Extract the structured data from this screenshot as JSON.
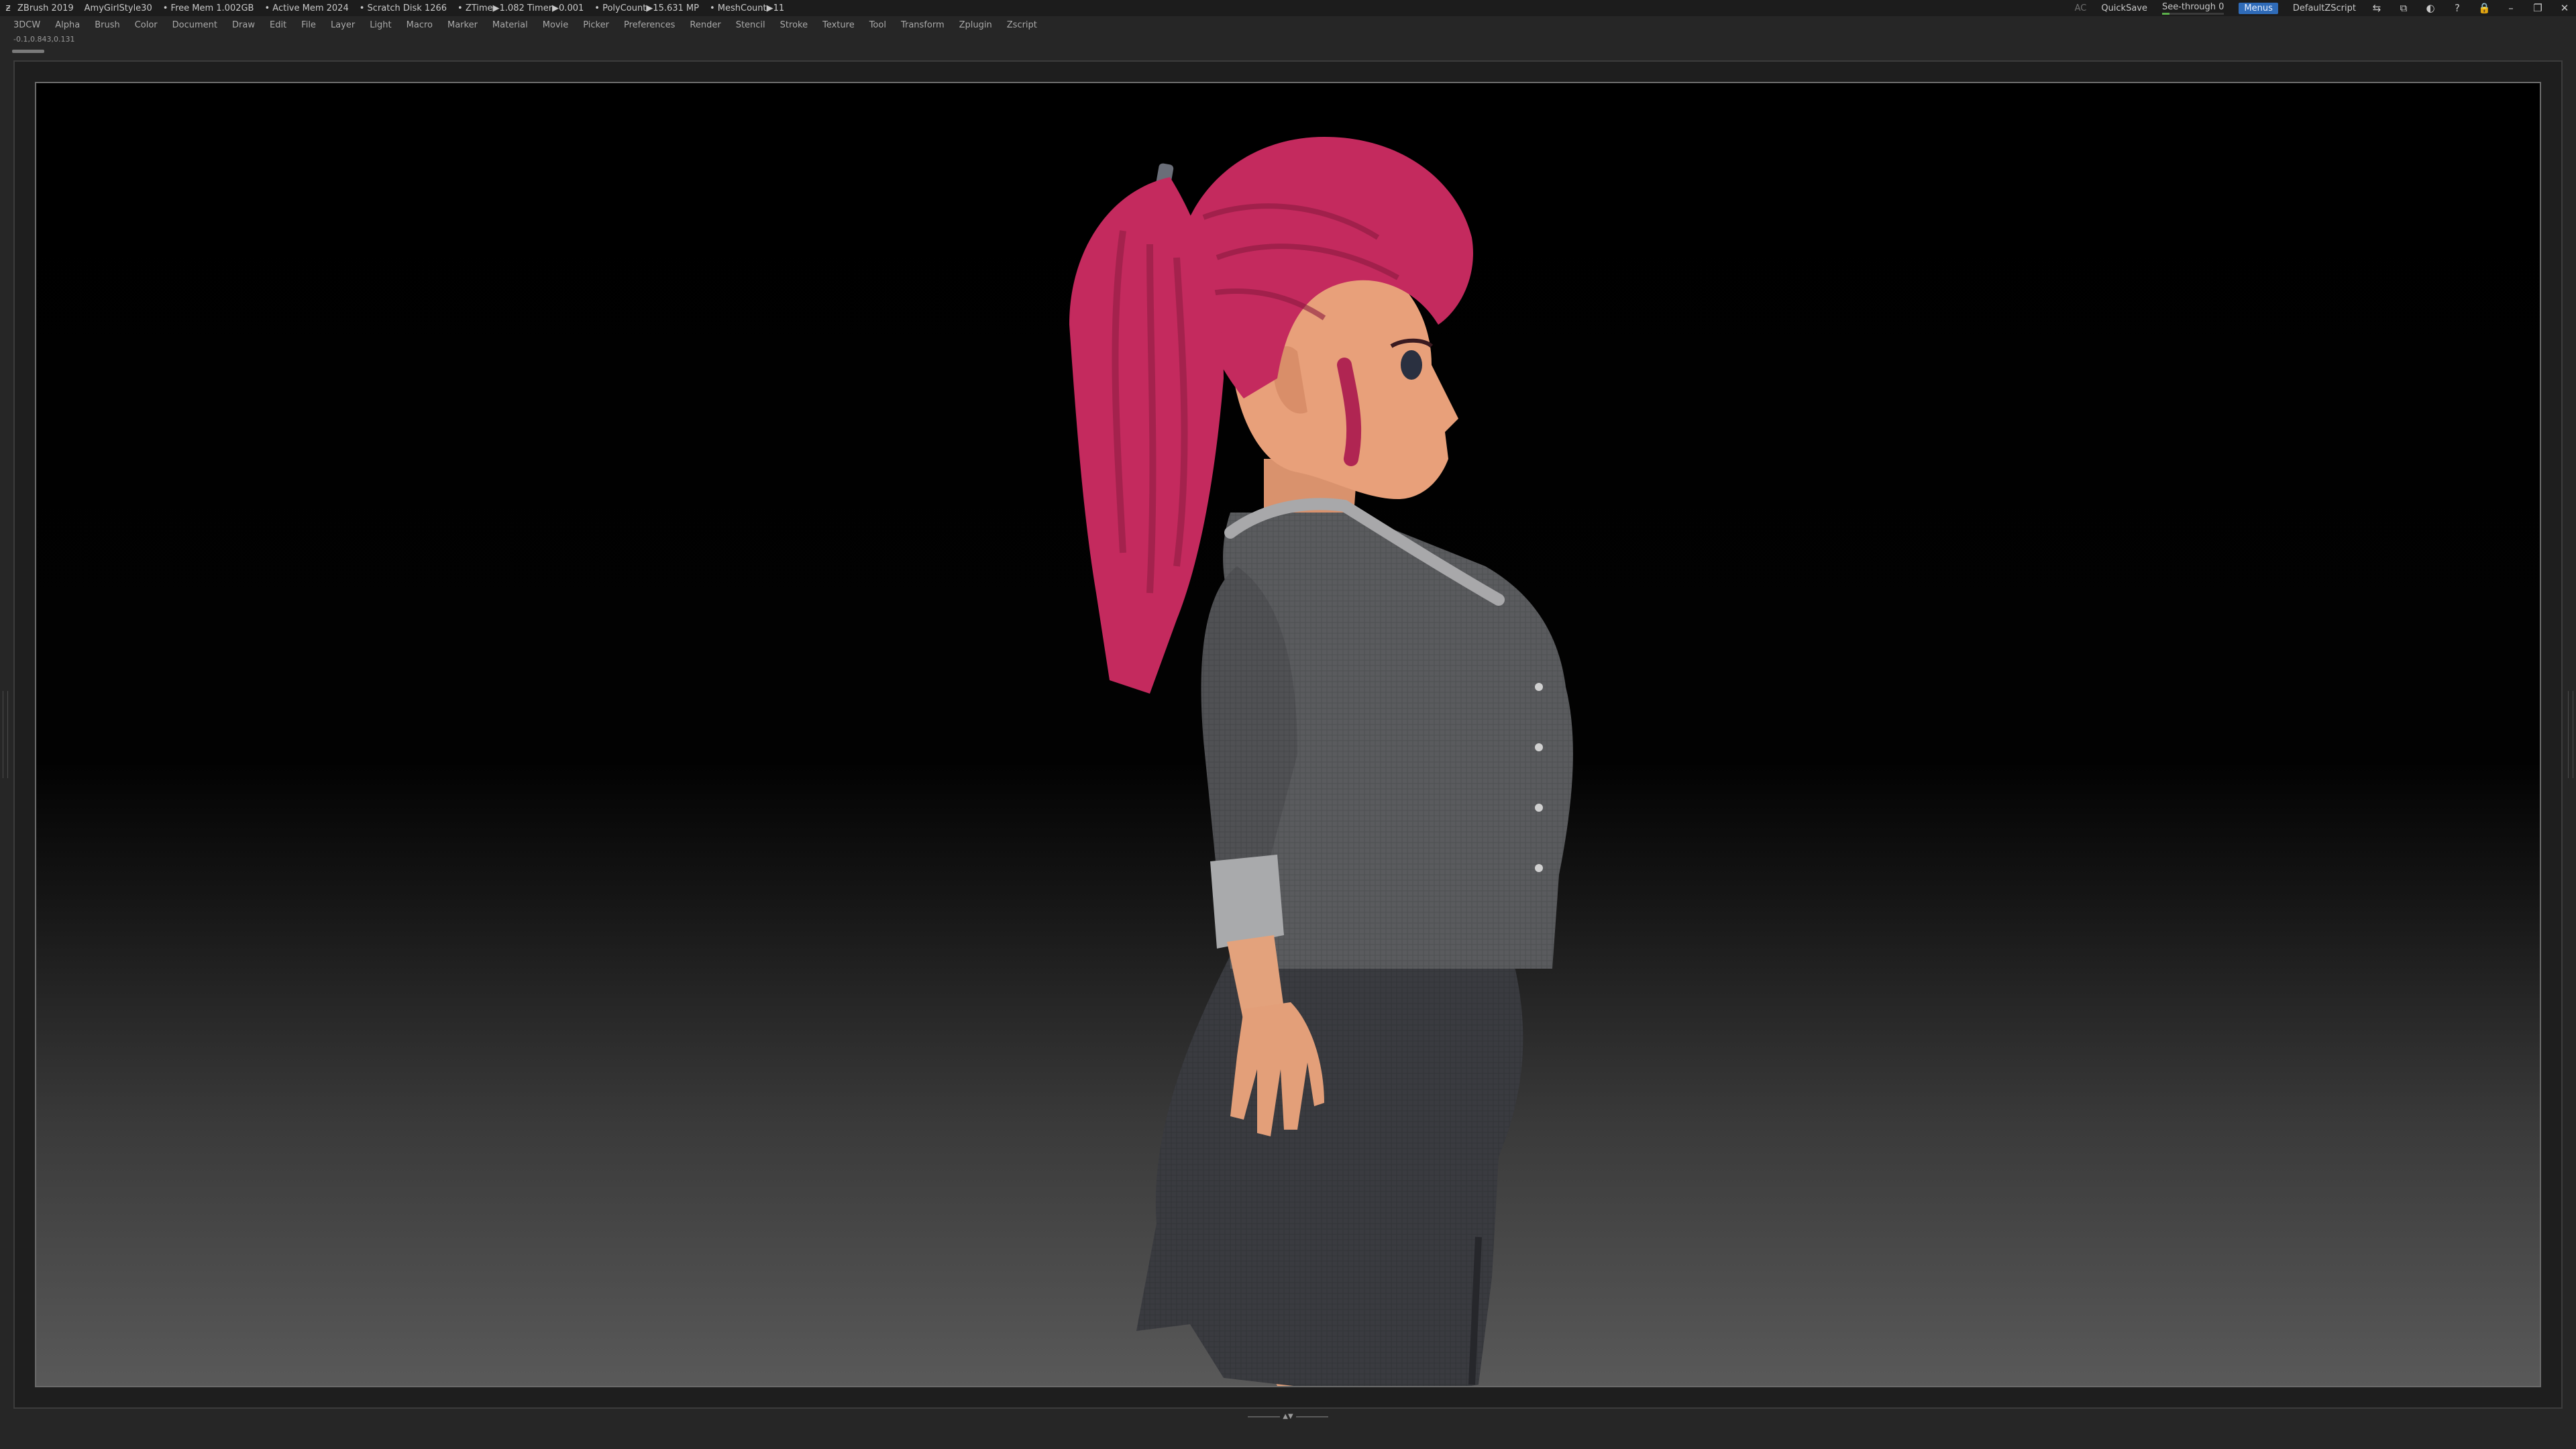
{
  "titlebar": {
    "app_name": "ZBrush 2019",
    "project": "AmyGirlStyle30",
    "stats": [
      "• Free Mem 1.002GB",
      "• Active Mem 2024",
      "• Scratch Disk 1266",
      "• ZTime▶1.082 Timer▶0.001",
      "• PolyCount▶15.631 MP",
      "• MeshCount▶11"
    ],
    "right_buttons": {
      "ac": "AC",
      "quicksave": "QuickSave",
      "see_through": "See-through 0",
      "see_through_value": 0,
      "menus": "Menus",
      "zscript": "DefaultZScript"
    }
  },
  "menubar": {
    "items": [
      "3DCW",
      "Alpha",
      "Brush",
      "Color",
      "Document",
      "Draw",
      "Edit",
      "File",
      "Layer",
      "Light",
      "Macro",
      "Marker",
      "Material",
      "Movie",
      "Picker",
      "Preferences",
      "Render",
      "Stencil",
      "Stroke",
      "Texture",
      "Tool",
      "Transform",
      "Zplugin",
      "Zscript"
    ]
  },
  "coords": "-0.1,0.843,0.131",
  "canvas": {
    "colors": {
      "hair": "#c42a5e",
      "hair_shadow": "#8a1b40",
      "skin": "#e8a07a",
      "skin_shadow": "#b8704e",
      "jacket": "#5a5b5e",
      "jacket_shadow": "#3e3f42",
      "trim": "#a8a8aa",
      "skirt": "#3a3b40",
      "skirt_shadow": "#26272b"
    }
  }
}
